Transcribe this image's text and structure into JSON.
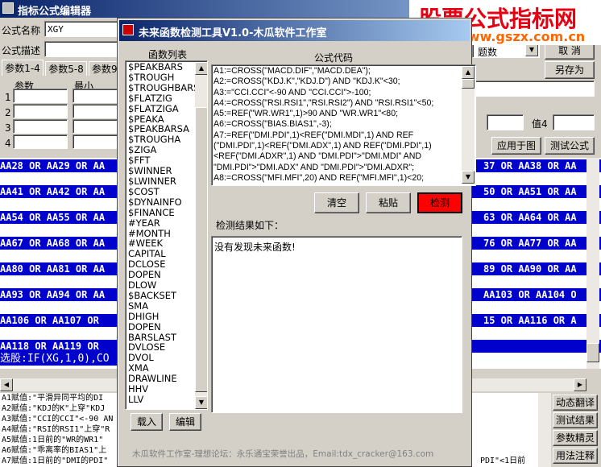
{
  "main": {
    "title": "指标公式编辑器",
    "name_label": "公式名称",
    "name_value": "XGY",
    "desc_label": "公式描述",
    "tabs": [
      "参数1-4",
      "参数5-8",
      "参数9"
    ],
    "param_headers": [
      "参数",
      "最小"
    ],
    "param_rows": [
      "1",
      "2",
      "3",
      "4"
    ],
    "right_top_value": "题数",
    "cancel_label": "取 消",
    "saveas_label": "另存为",
    "val4_label": "值4",
    "apply_label": "应用于图",
    "test_label": "测试公式",
    "code_rows": [
      "AA28 OR AA29 OR AA",
      "AA41 OR AA42 OR AA",
      "AA54 OR AA55 OR AA",
      "AA67 OR AA68 OR AA",
      "AA80 OR AA81 OR AA",
      "AA93 OR AA94 OR AA",
      "AA106 OR AA107 OR",
      "AA118 OR AA119 OR"
    ],
    "code_rows_right": [
      "37 OR AA38 OR AA",
      "50 OR AA51 OR AA",
      "63 OR AA64 OR AA",
      "76 OR AA77 OR AA",
      "89 OR AA90 OR AA",
      "AA103 OR AA104 O",
      "15 OR AA116 OR A",
      ""
    ],
    "select_line": "选股:IF(XG,1,0),CO",
    "bottom_lines": [
      "A1赋值:\"平滑异同平均的DI",
      "A2赋值:\"KDJ的K\"上穿\"KDJ",
      "A3赋值:\"CCI的CCI\"<-90 AN",
      "A4赋值:\"RSI的RSI1\"上穿\"R",
      "A5赋值:1日前的\"WR的WR1\"",
      "A6赋值:\"乖离率的BIAS1\"上",
      "A7赋值:1日前的\"DMI的PDI\""
    ],
    "bottom_right_fragment": "PDI\"<1日前",
    "side_buttons": [
      "动态翻译",
      "测试结果",
      "参数精灵",
      "用法注释"
    ]
  },
  "watermark": {
    "title": "股票公式指标网",
    "url": "www.gszx.com.cn"
  },
  "dialog": {
    "title": "未来函数检测工具V1.0-木瓜软件工作室",
    "func_list_label": "函数列表",
    "functions": [
      "$PEAKBARS",
      "$TROUGH",
      "$TROUGHBARS",
      "$FLATZIG",
      "$FLATZIGA",
      "$PEAKA",
      "$PEAKBARSA",
      "$TROUGHA",
      "$ZIGA",
      "$FFT",
      "$WINNER",
      "$LWINNER",
      "$COST",
      "$DYNAINFO",
      "$FINANCE",
      "#YEAR",
      "#MONTH",
      "#WEEK",
      "CAPITAL",
      "DCLOSE",
      "DOPEN",
      "DLOW",
      "$BACKSET",
      "SMA",
      "DHIGH",
      "DOPEN",
      "BARSLAST",
      "DVLOSE",
      "DVOL",
      "XMA",
      "DRAWLINE",
      "HHV",
      "LLV"
    ],
    "code_label": "公式代码",
    "code_lines": [
      "A1:=CROSS(\"MACD.DIF\",\"MACD.DEA\");",
      "A2:=CROSS(\"KDJ.K\",\"KDJ.D\") AND \"KDJ.K\"<30;",
      "A3:=\"CCI.CCI\"<-90 AND \"CCI.CCI\">-100;",
      "A4:=CROSS(\"RSI.RSI1\",\"RSI.RSI2\") AND \"RSI.RSI1\"<50;",
      "A5:=REF(\"WR.WR1\",1)>90 AND \"WR.WR1\"<80;",
      "A6:=CROSS(\"BIAS.BIAS1\",-3);",
      "A7:=REF(\"DMI.PDI\",1)<REF(\"DMI.MDI\",1) AND REF",
      "(\"DMI.PDI\",1)<REF(\"DMI.ADX\",1) AND REF(\"DMI.PDI\",1)",
      "<REF(\"DMI.ADXR\",1) AND \"DMI.PDI\">\"DMI.MDI\" AND",
      "\"DMI.PDI\">\"DMI.ADX\" AND \"DMI.PDI\">\"DMI.ADXR\";",
      "A8:=CROSS(\"MFI.MFI\",20) AND REF(\"MFI.MFI\",1)<20;"
    ],
    "clear_label": "清空",
    "paste_label": "粘贴",
    "detect_label": "检测",
    "result_label": "检测结果如下：",
    "result_text": "没有发现未来函数!",
    "load_label": "载入",
    "edit_label": "编辑",
    "footer": "木瓜软件工作室-理想论坛：永乐通宝荣誉出品，Email:tdx_cracker@163.com"
  },
  "colors": {
    "title_bar": "#0a246a",
    "code_bg": "#0000cc",
    "detect_btn": "#ff0000",
    "watermark_red": "#e60012",
    "watermark_url": "#ff6600"
  }
}
